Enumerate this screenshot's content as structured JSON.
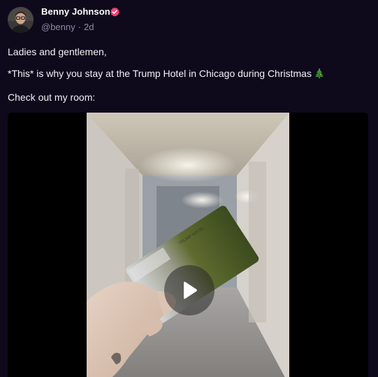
{
  "author": {
    "name": "Benny Johnson",
    "handle": "@benny",
    "separator": "·",
    "time_ago": "2d",
    "verified_icon": "verified-badge-icon",
    "verified_color": "#f0457a"
  },
  "post": {
    "line1": "Ladies and gentlemen,",
    "line2": "*This* is why you stay at the Trump Hotel in Chicago during Christmas",
    "line2_emoji": "christmas-tree-icon",
    "line3": "Check out my room:"
  },
  "media": {
    "type": "video",
    "play_icon": "play-icon",
    "card_text": "TRUMP HOTEL"
  },
  "colors": {
    "background": "#0e0a1c",
    "text": "#f2f1f6",
    "muted": "#8e8aa2"
  }
}
